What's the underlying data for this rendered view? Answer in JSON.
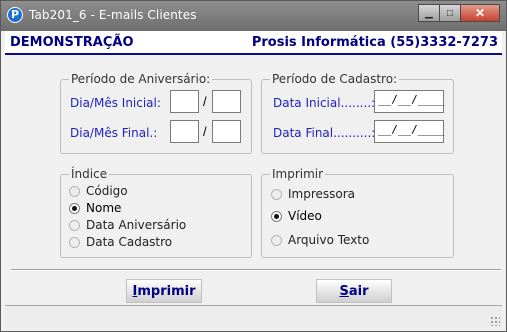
{
  "window": {
    "title": "Tab201_6 - E-mails Clientes",
    "app_icon_letter": "P"
  },
  "banner": {
    "left": "DEMONSTRAÇÃO",
    "right": "Prosis Informática (55)3332-7273"
  },
  "aniversario": {
    "legend": "Período de Aniversário:",
    "inicial_label": "Dia/Mês Inicial:",
    "final_label": "Dia/Mês Final.:",
    "slash": "/",
    "inicial_dia": "",
    "inicial_mes": "",
    "final_dia": "",
    "final_mes": ""
  },
  "cadastro": {
    "legend": "Período de Cadastro:",
    "inicial_label": "Data Inicial........:",
    "final_label": "Data Final..........:",
    "inicial_value": "__/__/____",
    "final_value": "__/__/____"
  },
  "indice": {
    "legend": "Índice",
    "options": [
      {
        "label": "Código",
        "selected": false
      },
      {
        "label": "Nome",
        "selected": true
      },
      {
        "label": "Data Aniversário",
        "selected": false
      },
      {
        "label": "Data Cadastro",
        "selected": false
      }
    ]
  },
  "imprimir_group": {
    "legend": "Imprimir",
    "options": [
      {
        "label": "Impressora",
        "selected": false
      },
      {
        "label": "Vídeo",
        "selected": true
      },
      {
        "label": "Arquivo Texto",
        "selected": false
      }
    ]
  },
  "buttons": {
    "imprimir": {
      "accel": "I",
      "rest": "mprimir"
    },
    "sair": {
      "accel": "S",
      "rest": "air"
    }
  }
}
